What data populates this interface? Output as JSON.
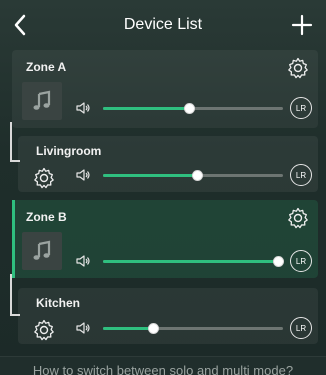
{
  "header": {
    "title": "Device List"
  },
  "zones": [
    {
      "name": "Zone A",
      "volume_pct": 48,
      "lr_label": "LR"
    },
    {
      "name": "Zone B",
      "volume_pct": 97,
      "lr_label": "LR"
    }
  ],
  "rooms": [
    {
      "name": "Livingroom",
      "volume_pct": 52,
      "lr_label": "LR"
    },
    {
      "name": "Kitchen",
      "volume_pct": 28,
      "lr_label": "LR"
    }
  ],
  "footer": {
    "help_text": "How to switch between solo and multi mode?"
  },
  "colors": {
    "accent": "#2fbf7f",
    "background": "#1f2e2b",
    "track": "#6d7572"
  },
  "icons": [
    "back-arrow-icon",
    "plus-icon",
    "gear-icon",
    "music-note-icon",
    "speaker-icon",
    "lr-icon"
  ]
}
